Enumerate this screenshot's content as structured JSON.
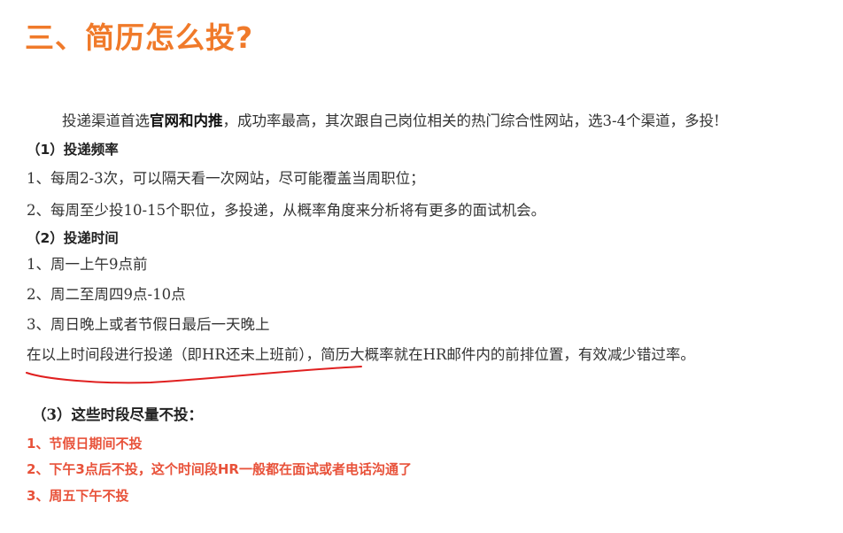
{
  "title": "三、简历怎么投?",
  "intro": {
    "before": "投递渠道首选",
    "bold": "官网和内推",
    "after": "，成功率最高，其次跟自己岗位相关的热门综合性网站，选3-4个渠道，多投!"
  },
  "section1": {
    "heading": "（1）投递频率",
    "items": [
      "1、每周2-3次，可以隔天看一次网站，尽可能覆盖当周职位；",
      "2、每周至少投10-15个职位，多投递，从概率角度来分析将有更多的面试机会。"
    ]
  },
  "section2": {
    "heading": "（2）投递时间",
    "items": [
      "1、周一上午9点前",
      "2、周二至周四9点-10点",
      "3、周日晚上或者节假日最后一天晚上"
    ],
    "note": "在以上时间段进行投递（即HR还未上班前），简历大概率就在HR邮件内的前排位置，有效减少错过率。"
  },
  "section3": {
    "heading": "（3）这些时段尽量不投：",
    "items": [
      "1、节假日期间不投",
      "2、下午3点后不投，这个时间段HR一般都在面试或者电话沟通了",
      "3、周五下午不投"
    ]
  },
  "colors": {
    "title": "#f07a2a",
    "warning": "#e8523a",
    "annotation": "#e02020"
  }
}
